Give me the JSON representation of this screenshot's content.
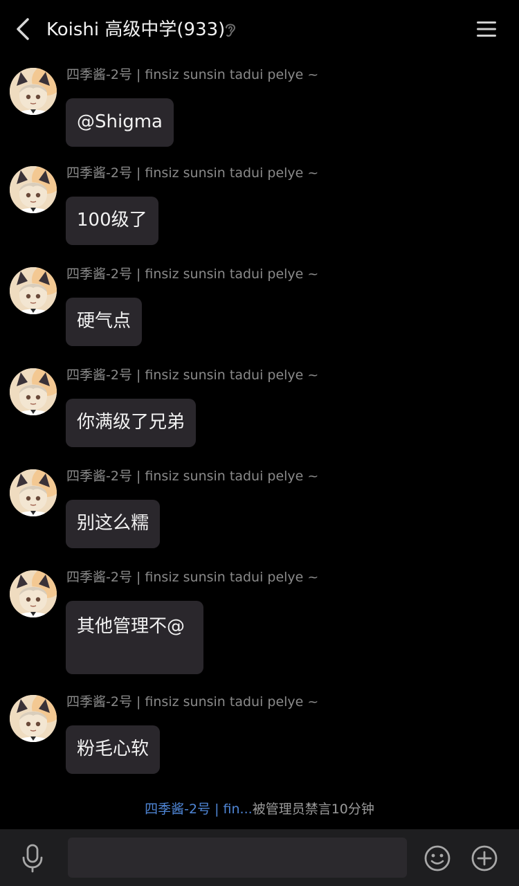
{
  "header": {
    "title": "Koishi 高级中学(933)",
    "back_icon": "chevron-left-icon",
    "ear_icon": "ear-icon",
    "menu_icon": "menu-icon"
  },
  "messages": [
    {
      "sender": "四季酱-2号 | finsiz sunsin tadui pelye ~",
      "text": "@Shigma"
    },
    {
      "sender": "四季酱-2号 | finsiz sunsin tadui pelye ~",
      "text": "100级了"
    },
    {
      "sender": "四季酱-2号 | finsiz sunsin tadui pelye ~",
      "text": "硬气点"
    },
    {
      "sender": "四季酱-2号 | finsiz sunsin tadui pelye ~",
      "text": "你满级了兄弟"
    },
    {
      "sender": "四季酱-2号 | finsiz sunsin tadui pelye ~",
      "text": "别这么糯"
    },
    {
      "sender": "四季酱-2号 | finsiz sunsin tadui pelye ~",
      "text": "其他管理不@"
    },
    {
      "sender": "四季酱-2号 | finsiz sunsin tadui pelye ~",
      "text": "粉毛心软"
    }
  ],
  "notice": {
    "who": "四季酱-2号 | fin...",
    "text": "被管理员禁言10分钟"
  },
  "composer": {
    "input_value": "",
    "mic_icon": "microphone-icon",
    "emoji_icon": "emoji-icon",
    "plus_icon": "plus-icon"
  },
  "colors": {
    "background": "#000000",
    "bubble": "#2a272c",
    "sender_text": "#8a8a8a",
    "notice_link": "#4f86d6",
    "bottom_bar": "#1e1e20"
  }
}
